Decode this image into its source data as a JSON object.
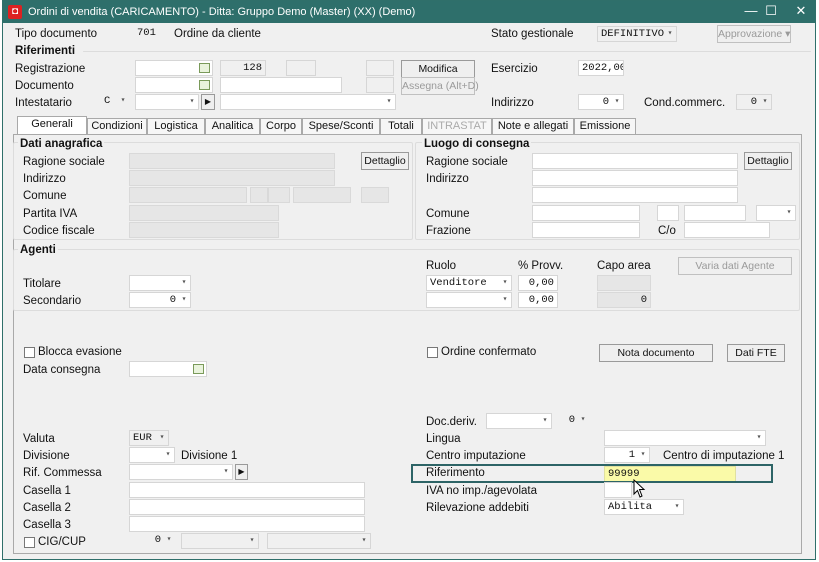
{
  "window": {
    "title": "Ordini di vendita (CARICAMENTO) - Ditta: Gruppo Demo (Master) (XX) (Demo)",
    "minimize": "—",
    "maximize": "☐",
    "close": "✕"
  },
  "header": {
    "tipo_documento_label": "Tipo documento",
    "tipo_documento_code": "701",
    "tipo_documento_desc": "Ordine da cliente",
    "stato_label": "Stato gestionale",
    "stato_value": "DEFINITIVO",
    "approvazione": "Approvazione"
  },
  "riferimenti": {
    "title": "Riferimenti",
    "registrazione_label": "Registrazione",
    "registrazione_num": "128",
    "documento_label": "Documento",
    "intestatario_label": "Intestatario",
    "intestatario_type": "C",
    "modifica": "Modifica",
    "assegna": "Assegna (Alt+D)",
    "esercizio_label": "Esercizio",
    "esercizio_value": "2022,00",
    "indirizzo_label": "Indirizzo",
    "indirizzo_value": "0",
    "cond_label": "Cond.commerc.",
    "cond_value": "0"
  },
  "tabs": [
    "Generali",
    "Condizioni",
    "Logistica",
    "Analitica",
    "Corpo",
    "Spese/Sconti",
    "Totali",
    "INTRASTAT",
    "Note e allegati",
    "Emissione"
  ],
  "anagrafica": {
    "title": "Dati anagrafica",
    "ragione_sociale": "Ragione sociale",
    "indirizzo": "Indirizzo",
    "comune": "Comune",
    "partita_iva": "Partita IVA",
    "codice_fiscale": "Codice fiscale",
    "dettaglio": "Dettaglio"
  },
  "consegna": {
    "title": "Luogo di consegna",
    "ragione_sociale": "Ragione sociale",
    "indirizzo": "Indirizzo",
    "comune": "Comune",
    "frazione": "Frazione",
    "co": "C/o",
    "dettaglio": "Dettaglio"
  },
  "agenti": {
    "title": "Agenti",
    "titolare": "Titolare",
    "secondario": "Secondario",
    "secondario_value": "0",
    "ruolo": "Ruolo",
    "provv": "% Provv.",
    "capo_area": "Capo area",
    "varia": "Varia dati Agente",
    "ruolo1": "Venditore",
    "provv1": "0,00",
    "provv2": "0,00",
    "capo_value": "0"
  },
  "generali": {
    "blocca_evasione": "Blocca evasione",
    "data_consegna": "Data consegna",
    "ordine_confermato": "Ordine confermato",
    "nota_documento": "Nota documento",
    "dati_fte": "Dati FTE",
    "doc_deriv": "Doc.deriv.",
    "doc_deriv_value": "0",
    "valuta": "Valuta",
    "valuta_value": "EUR",
    "divisione": "Divisione",
    "divisione_desc": "Divisione 1",
    "rif_commessa": "Rif. Commessa",
    "casella1": "Casella 1",
    "casella2": "Casella 2",
    "casella3": "Casella 3",
    "cig_cup": "CIG/CUP",
    "cig_value": "0",
    "lingua": "Lingua",
    "centro_imputazione": "Centro imputazione",
    "centro_value": "1",
    "centro_desc": "Centro di imputazione 1",
    "riferimento": "Riferimento",
    "riferimento_value": "99999",
    "iva_no_imp": "IVA no imp./agevolata",
    "rilevazione": "Rilevazione addebiti",
    "rilevazione_value": "Abilita"
  }
}
